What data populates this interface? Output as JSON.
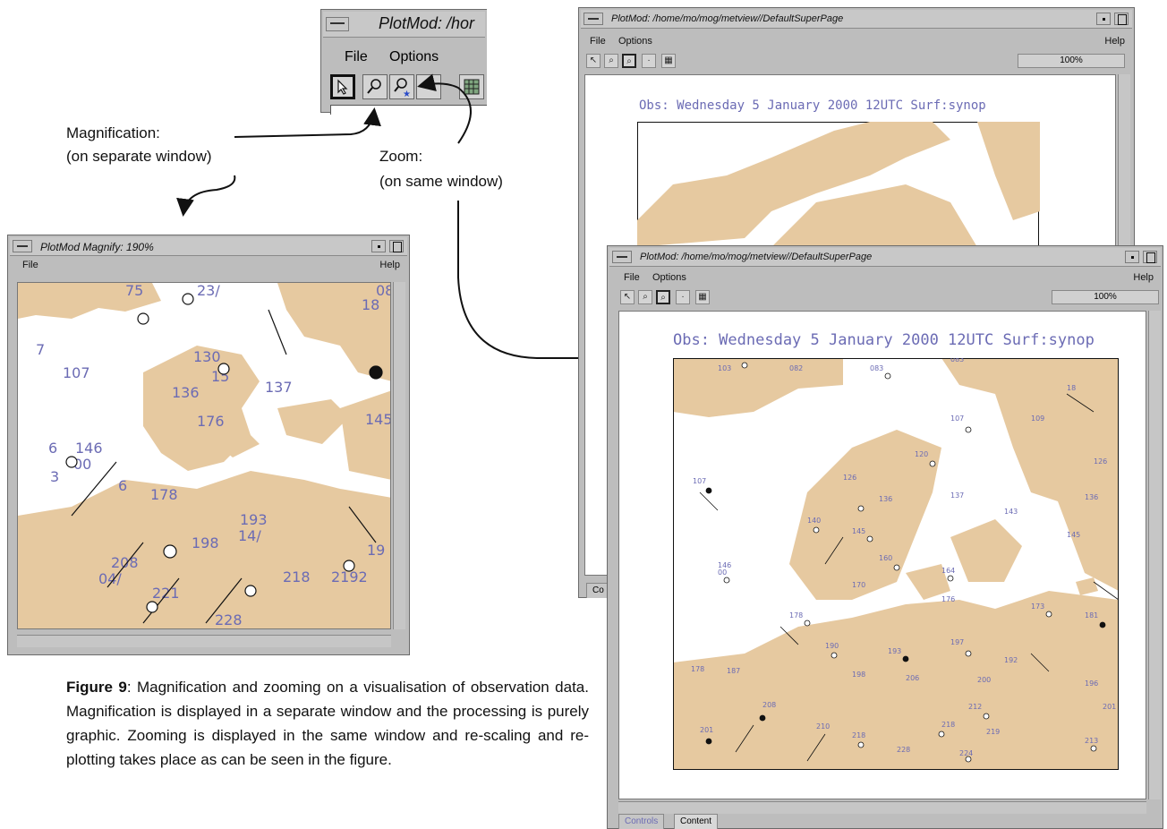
{
  "annotations": {
    "magnification_label": "Magnification:",
    "magnification_sub": "(on separate window)",
    "zoom_label": "Zoom:",
    "zoom_sub": "(on same window)"
  },
  "toolbar_crop": {
    "title": "PlotMod: /hor",
    "menu_file": "File",
    "menu_options": "Options"
  },
  "magnify_window": {
    "title": "PlotMod Magnify: 190%",
    "menu_file": "File",
    "menu_help": "Help"
  },
  "back_window": {
    "title": "PlotMod: /home/mo/mog/metview//DefaultSuperPage",
    "menu_file": "File",
    "menu_options": "Options",
    "menu_help": "Help",
    "zoom_value": "100%",
    "map_title": "Obs: Wednesday 5 January 2000 12UTC Surf:synop",
    "tab_controls": "Co"
  },
  "front_window": {
    "title": "PlotMod: /home/mo/mog/metview//DefaultSuperPage",
    "menu_file": "File",
    "menu_options": "Options",
    "menu_help": "Help",
    "zoom_value": "100%",
    "map_title": "Obs: Wednesday 5 January 2000 12UTC Surf:synop",
    "tab_controls": "Controls",
    "tab_content": "Content"
  },
  "caption": {
    "bold": "Figure 9",
    "text": ": Magnification and zooming on a visualisation of observation data. Magnification is displayed in a separate window and the processing is purely graphic. Zooming is displayed in the same window and re-scaling and re-plotting takes place as can be seen in the figure."
  },
  "colors": {
    "land": "#e6c9a0",
    "obs_text": "#6b6bb4",
    "window_grey": "#bdbdbd"
  }
}
